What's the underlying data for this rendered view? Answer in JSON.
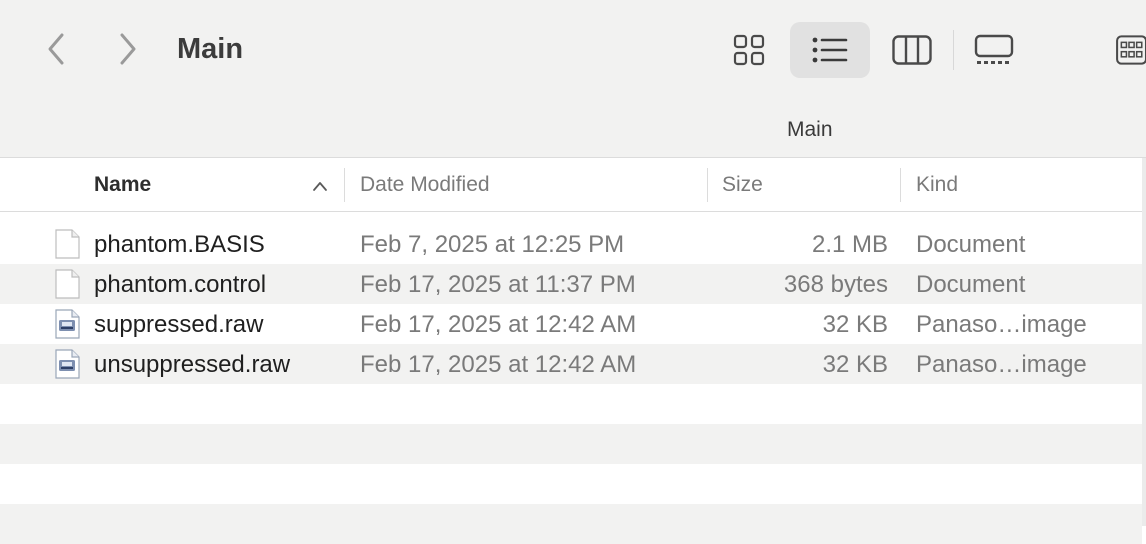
{
  "toolbar": {
    "title": "Main",
    "path_label": "Main",
    "back_icon": "chevron-left-icon",
    "forward_icon": "chevron-right-icon",
    "views": [
      {
        "name": "icon-view",
        "icon": "grid-icon",
        "active": false
      },
      {
        "name": "list-view",
        "icon": "list-icon",
        "active": true
      },
      {
        "name": "column-view",
        "icon": "columns-icon",
        "active": false
      },
      {
        "name": "gallery-view",
        "icon": "gallery-icon",
        "active": false
      },
      {
        "name": "group-view",
        "icon": "group-icon",
        "active": false
      }
    ]
  },
  "columns": {
    "name": "Name",
    "date": "Date Modified",
    "size": "Size",
    "kind": "Kind",
    "sort_icon": "chevron-up-icon"
  },
  "files": [
    {
      "name": "phantom.BASIS",
      "date": "Feb 7, 2025 at 12:25 PM",
      "size": "2.1 MB",
      "kind": "Document",
      "icon": "document-icon"
    },
    {
      "name": "phantom.control",
      "date": "Feb 17, 2025 at 11:37 PM",
      "size": "368 bytes",
      "kind": "Document",
      "icon": "document-icon"
    },
    {
      "name": "suppressed.raw",
      "date": "Feb 17, 2025 at 12:42 AM",
      "size": "32 KB",
      "kind": "Panaso…image",
      "icon": "raw-image-icon"
    },
    {
      "name": "unsuppressed.raw",
      "date": "Feb 17, 2025 at 12:42 AM",
      "size": "32 KB",
      "kind": "Panaso…image",
      "icon": "raw-image-icon"
    }
  ],
  "colors": {
    "toolbar_bg": "#f2f2f1",
    "alt_row": "#f2f2f1",
    "active_view_bg": "#e1e1e1"
  }
}
